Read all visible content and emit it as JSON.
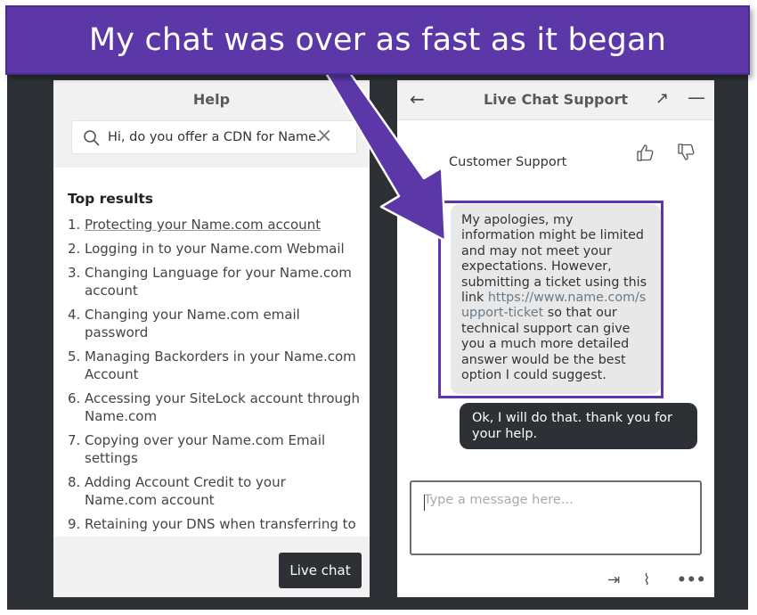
{
  "banner": {
    "title": "My chat was over as fast as it began"
  },
  "help": {
    "title": "Help",
    "search": {
      "value": "Hi, do you offer a CDN for Name."
    },
    "top_results_label": "Top results",
    "results": [
      {
        "num": "1.",
        "label": "Protecting your Name.com account"
      },
      {
        "num": "2.",
        "label": "Logging in to your Name.com Webmail"
      },
      {
        "num": "3.",
        "label": "Changing Language for your Name.com account"
      },
      {
        "num": "4.",
        "label": "Changing your Name.com email password"
      },
      {
        "num": "5.",
        "label": "Managing Backorders in your Name.com Account"
      },
      {
        "num": "6.",
        "label": "Accessing your SiteLock account through Name.com"
      },
      {
        "num": "7.",
        "label": "Copying over your Name.com Email settings"
      },
      {
        "num": "8.",
        "label": "Adding Account Credit to your Name.com account"
      },
      {
        "num": "9.",
        "label": "Retaining your DNS when transferring to Name.com"
      }
    ],
    "live_chat_button": "Live chat"
  },
  "chat": {
    "title": "Live Chat Support",
    "agent_name": "Customer Support",
    "messages": {
      "incoming_before_link": "My apologies, my information might be limited and may not meet your expectations. However, submitting a ticket using this link ",
      "incoming_link": "https://www.name.com/support-ticket",
      "incoming_after_link": " so that our technical support can give you a much more detailed answer would be the best option I could suggest.",
      "outgoing": "Ok, I will do that. thank you for your help."
    },
    "input": {
      "placeholder": "Type a message here..."
    }
  },
  "colors": {
    "accent": "#5b37a8",
    "dark": "#2d3135",
    "panel_header": "#f1f1f1"
  }
}
